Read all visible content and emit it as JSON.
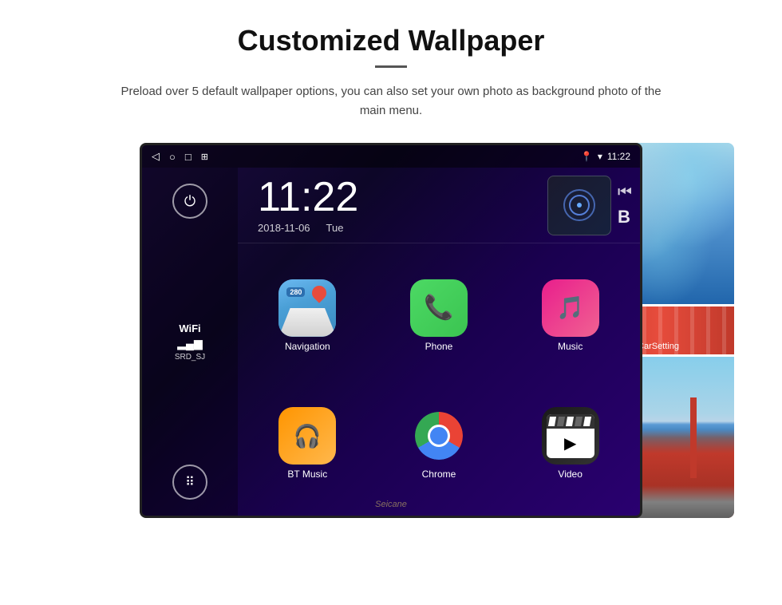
{
  "header": {
    "title": "Customized Wallpaper",
    "description": "Preload over 5 default wallpaper options, you can also set your own photo as background photo of the main menu."
  },
  "android": {
    "status_bar": {
      "back_icon": "◁",
      "home_icon": "○",
      "recent_icon": "□",
      "screenshot_icon": "⊞",
      "location_icon": "▾",
      "wifi_icon": "▾",
      "time": "11:22"
    },
    "clock": {
      "time": "11:22",
      "date": "2018-11-06",
      "day": "Tue"
    },
    "wifi": {
      "label": "WiFi",
      "ssid": "SRD_SJ"
    },
    "apps": [
      {
        "name": "Navigation",
        "type": "navigation"
      },
      {
        "name": "Phone",
        "type": "phone"
      },
      {
        "name": "Music",
        "type": "music"
      },
      {
        "name": "BT Music",
        "type": "btmusic"
      },
      {
        "name": "Chrome",
        "type": "chrome"
      },
      {
        "name": "Video",
        "type": "video"
      }
    ],
    "nav_badge": "280",
    "media_prev": "⏮",
    "media_letter": "B"
  },
  "wallpaper": {
    "car_setting_label": "CarSetting"
  },
  "watermark": "Seicane"
}
